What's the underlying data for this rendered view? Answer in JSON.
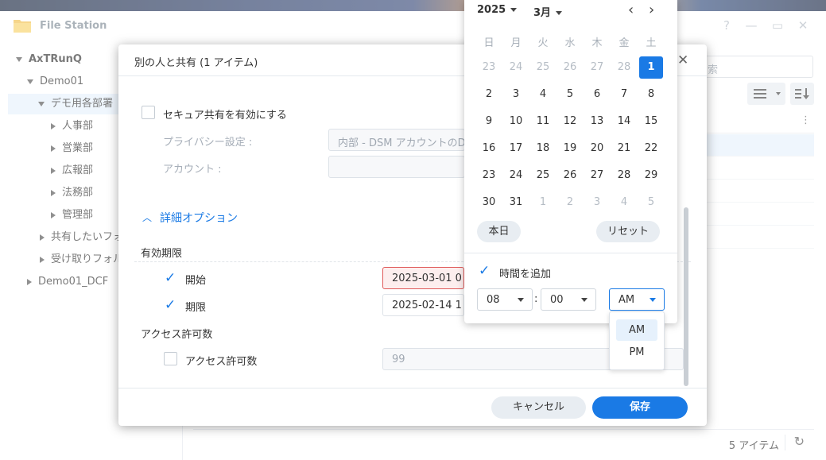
{
  "app": {
    "title": "File Station",
    "controls": {
      "help": "?",
      "minimize": "—",
      "maximize": "▭",
      "close": "✕"
    }
  },
  "sidebar": {
    "items": [
      {
        "label": "AxTRunQ",
        "level": 0,
        "expanded": true,
        "bold": true
      },
      {
        "label": "Demo01",
        "level": 1,
        "expanded": true
      },
      {
        "label": "デモ用各部署",
        "level": 2,
        "expanded": true,
        "selected": true
      },
      {
        "label": "人事部",
        "level": 3
      },
      {
        "label": "営業部",
        "level": 3
      },
      {
        "label": "広報部",
        "level": 3
      },
      {
        "label": "法務部",
        "level": 3
      },
      {
        "label": "管理部",
        "level": 3
      },
      {
        "label": "共有したいフォ",
        "level": 2
      },
      {
        "label": "受け取りフォル",
        "level": 2
      },
      {
        "label": "Demo01_DCF",
        "level": 1
      }
    ]
  },
  "main": {
    "search_placeholder": "索",
    "item_count": "5 アイテム"
  },
  "dialog": {
    "title": "別の人と共有 (1 アイテム)",
    "secure_share_label": "セキュア共有を有効にする",
    "privacy_label": "プライバシー設定 :",
    "privacy_value": "内部 - DSM アカウントのD",
    "account_label": "アカウント :",
    "advanced_label": "詳細オプション",
    "validity_label": "有効期限",
    "start_label": "開始",
    "start_value": "2025-03-01 0",
    "end_label": "期限",
    "end_value": "2025-02-14 1",
    "access_section_label": "アクセス許可数",
    "access_label": "アクセス許可数",
    "access_value": "99",
    "cancel_label": "キャンセル",
    "save_label": "保存"
  },
  "calendar": {
    "year": "2025",
    "month": "3月",
    "weekdays": [
      "日",
      "月",
      "火",
      "水",
      "木",
      "金",
      "土"
    ],
    "weeks": [
      [
        {
          "d": "23",
          "out": true
        },
        {
          "d": "24",
          "out": true
        },
        {
          "d": "25",
          "out": true
        },
        {
          "d": "26",
          "out": true
        },
        {
          "d": "27",
          "out": true
        },
        {
          "d": "28",
          "out": true
        },
        {
          "d": "1",
          "sel": true
        }
      ],
      [
        {
          "d": "2"
        },
        {
          "d": "3"
        },
        {
          "d": "4"
        },
        {
          "d": "5"
        },
        {
          "d": "6"
        },
        {
          "d": "7"
        },
        {
          "d": "8"
        }
      ],
      [
        {
          "d": "9"
        },
        {
          "d": "10"
        },
        {
          "d": "11"
        },
        {
          "d": "12"
        },
        {
          "d": "13"
        },
        {
          "d": "14"
        },
        {
          "d": "15"
        }
      ],
      [
        {
          "d": "16"
        },
        {
          "d": "17"
        },
        {
          "d": "18"
        },
        {
          "d": "19"
        },
        {
          "d": "20"
        },
        {
          "d": "21"
        },
        {
          "d": "22"
        }
      ],
      [
        {
          "d": "23"
        },
        {
          "d": "24"
        },
        {
          "d": "25"
        },
        {
          "d": "26"
        },
        {
          "d": "27"
        },
        {
          "d": "28"
        },
        {
          "d": "29"
        }
      ],
      [
        {
          "d": "30"
        },
        {
          "d": "31"
        },
        {
          "d": "1",
          "out": true
        },
        {
          "d": "2",
          "out": true
        },
        {
          "d": "3",
          "out": true
        },
        {
          "d": "4",
          "out": true
        },
        {
          "d": "5",
          "out": true
        }
      ]
    ],
    "today_label": "本日",
    "reset_label": "リセット",
    "add_time_label": "時間を追加",
    "hour": "08",
    "colon": ":",
    "minute": "00",
    "ampm": "AM",
    "ampm_options": [
      "AM",
      "PM"
    ]
  },
  "colors": {
    "accent": "#1a7ae5",
    "error": "#e05a5a"
  }
}
